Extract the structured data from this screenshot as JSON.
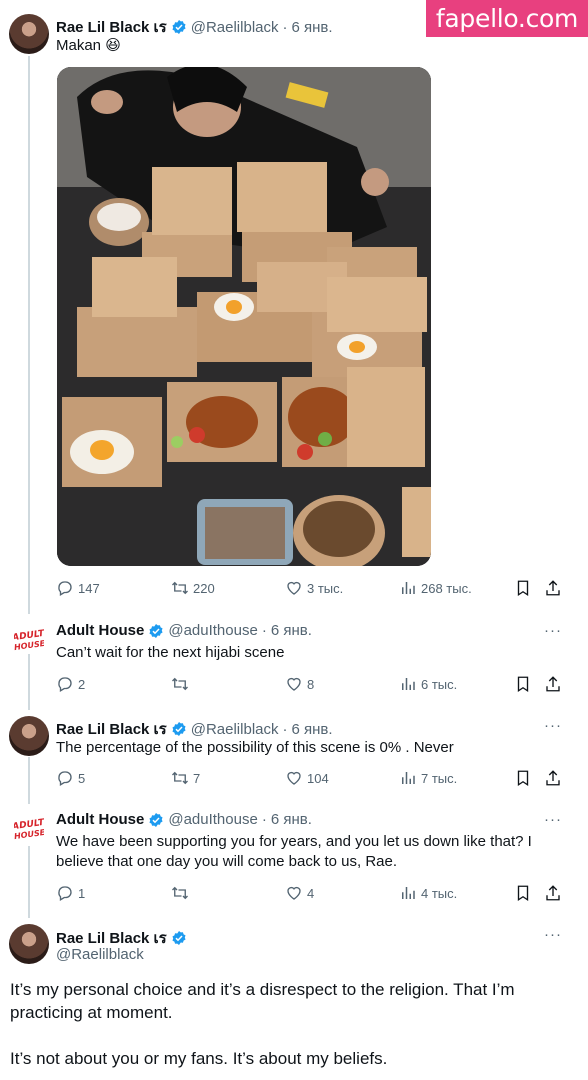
{
  "watermark": "fapello.com",
  "tweets": [
    {
      "name": "Rae Lil Black เร",
      "handle": "@Raelilblack",
      "date": "6 янв.",
      "text": "Makan 😆",
      "stats": {
        "replies": "147",
        "retweets": "220",
        "likes": "3 тыс.",
        "views": "268 тыс."
      }
    },
    {
      "name": "Adult House",
      "handle": "@aduIthouse",
      "date": "6 янв.",
      "text": "Can’t wait for the next hijabi scene",
      "stats": {
        "replies": "2",
        "retweets": "",
        "likes": "8",
        "views": "6 тыс."
      },
      "logo": {
        "line1": "ADULT",
        "line2": "HOUSE"
      }
    },
    {
      "name": "Rae Lil Black เร",
      "handle": "@Raelilblack",
      "date": "6 янв.",
      "text": "The percentage of the possibility of this scene is  0% . Never",
      "stats": {
        "replies": "5",
        "retweets": "7",
        "likes": "104",
        "views": "7 тыс."
      }
    },
    {
      "name": "Adult House",
      "handle": "@aduIthouse",
      "date": "6 янв.",
      "text": "We have been supporting you for years, and you let us down like that? I believe that one day you will come back to us, Rae.",
      "stats": {
        "replies": "1",
        "retweets": "",
        "likes": "4",
        "views": "4 тыс."
      },
      "logo": {
        "line1": "ADULT",
        "line2": "HOUSE"
      }
    }
  ],
  "focused": {
    "name": "Rae Lil Black เร",
    "handle": "@Raelilblack",
    "para1": "It’s my personal choice and it’s a disrespect to the religion. That I’m practicing at moment.",
    "para2": "It’s not about you or my fans. It’s about my beliefs."
  },
  "more_label": "···",
  "colors": {
    "accent": "#1d9bf0",
    "muted": "#536471",
    "watermark": "#e8407f"
  },
  "icons": [
    "reply-icon",
    "retweet-icon",
    "like-icon",
    "views-icon",
    "bookmark-icon",
    "share-icon",
    "verified-badge-icon",
    "more-icon"
  ]
}
